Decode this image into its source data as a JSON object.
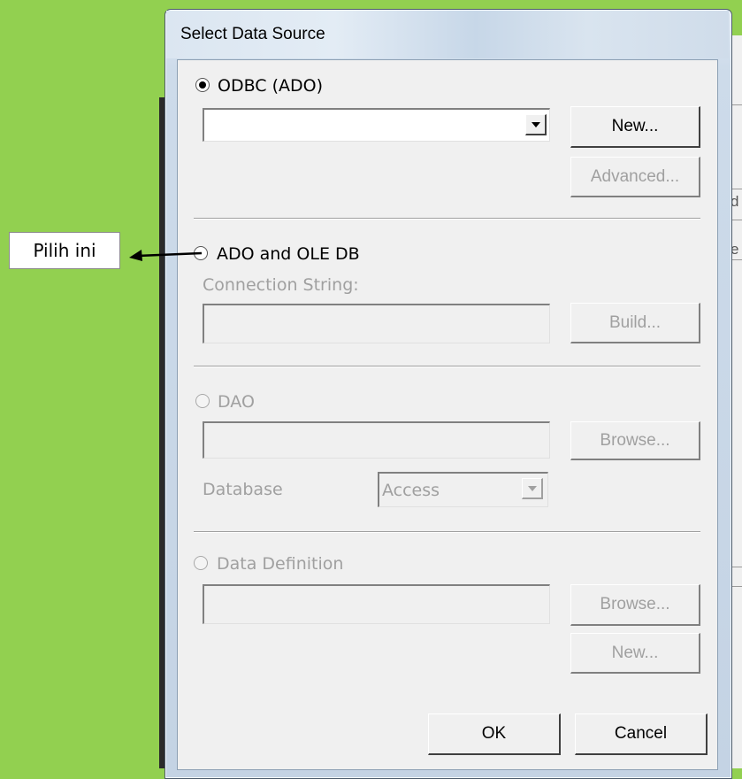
{
  "dialog": {
    "title": "Select Data Source"
  },
  "odbc": {
    "label": "ODBC (ADO)",
    "selected": true,
    "dsn_value": "",
    "new_label": "New...",
    "advanced_label": "Advanced..."
  },
  "ado": {
    "label": "ADO and OLE DB",
    "selected": false,
    "connection_label": "Connection String:",
    "connection_value": "",
    "build_label": "Build..."
  },
  "dao": {
    "label": "DAO",
    "path_value": "",
    "browse_label": "Browse...",
    "database_label": "Database",
    "database_value": "Access"
  },
  "datadef": {
    "label": "Data Definition",
    "path_value": "",
    "browse_label": "Browse...",
    "new_label": "New..."
  },
  "footer": {
    "ok_label": "OK",
    "cancel_label": "Cancel"
  },
  "annotation": {
    "callout_text": "Pilih ini"
  },
  "background_window": {
    "chars": [
      "d",
      "e"
    ]
  },
  "colors": {
    "background": "#92d050",
    "arrow": "#000000"
  }
}
